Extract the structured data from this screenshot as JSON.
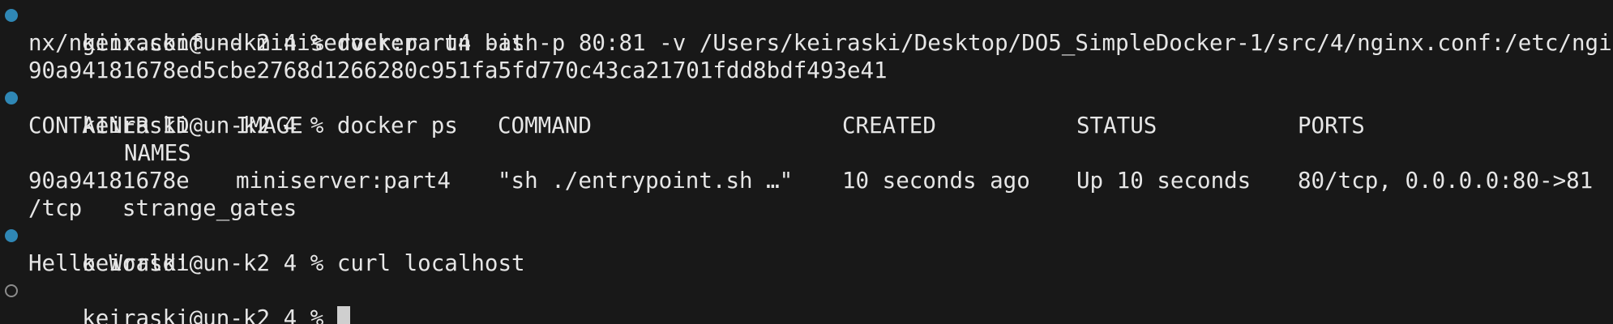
{
  "terminal": {
    "prompt": "keiraski@un-k2 4 % ",
    "blocks": [
      {
        "status": "success",
        "command": "docker run -it -p 80:81 -v /Users/keiraski/Desktop/DO5_SimpleDocker-1/src/4/nginx.conf:/etc/ngi",
        "command_cont": "nx/nginx.conf -d miniserver:part4 bash",
        "output": [
          "90a94181678ed5cbe2768d1266280c951fa5fd770c43ca21701fdd8bdf493e41"
        ]
      },
      {
        "status": "success",
        "command": "docker ps",
        "table": {
          "headers": [
            "CONTAINER ID",
            "IMAGE",
            "COMMAND",
            "CREATED",
            "STATUS",
            "PORTS"
          ],
          "headers_wrap": "NAMES",
          "row": [
            "90a94181678e",
            "miniserver:part4",
            "\"sh ./entrypoint.sh …\"",
            "10 seconds ago",
            "Up 10 seconds",
            "80/tcp, 0.0.0.0:80->81"
          ],
          "row_wrap": "/tcp   strange_gates"
        }
      },
      {
        "status": "success",
        "command": "curl localhost",
        "output": [
          "Hello World!"
        ]
      },
      {
        "status": "pending",
        "command": ""
      }
    ]
  }
}
